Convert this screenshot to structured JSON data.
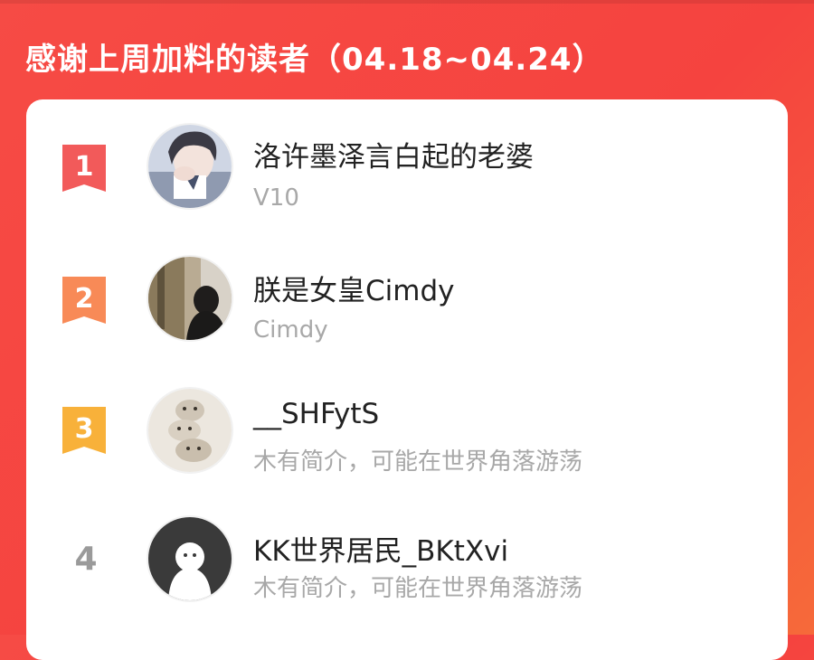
{
  "header": {
    "title": "感谢上周加料的读者（04.18~04.24）"
  },
  "colors": {
    "rank1": "#f25a5a",
    "rank2": "#f88a57",
    "rank3": "#f8b13a",
    "rank_plain": "#9a9a9a"
  },
  "readers": [
    {
      "rank": "1",
      "name": "洛许墨泽言白起的老婆",
      "subtitle": "V10",
      "avatar": "anime-boy-avatar"
    },
    {
      "rank": "2",
      "name": "朕是女皇Cimdy",
      "subtitle": "Cimdy",
      "avatar": "photo-avatar"
    },
    {
      "rank": "3",
      "name": "__SHFytS",
      "subtitle": "木有简介，可能在世界角落游荡",
      "avatar": "stacked-bunnies-avatar"
    },
    {
      "rank": "4",
      "name": "KK世界居民_BKtXvi",
      "subtitle": "木有简介，可能在世界角落游荡",
      "avatar": "default-user-avatar"
    }
  ]
}
